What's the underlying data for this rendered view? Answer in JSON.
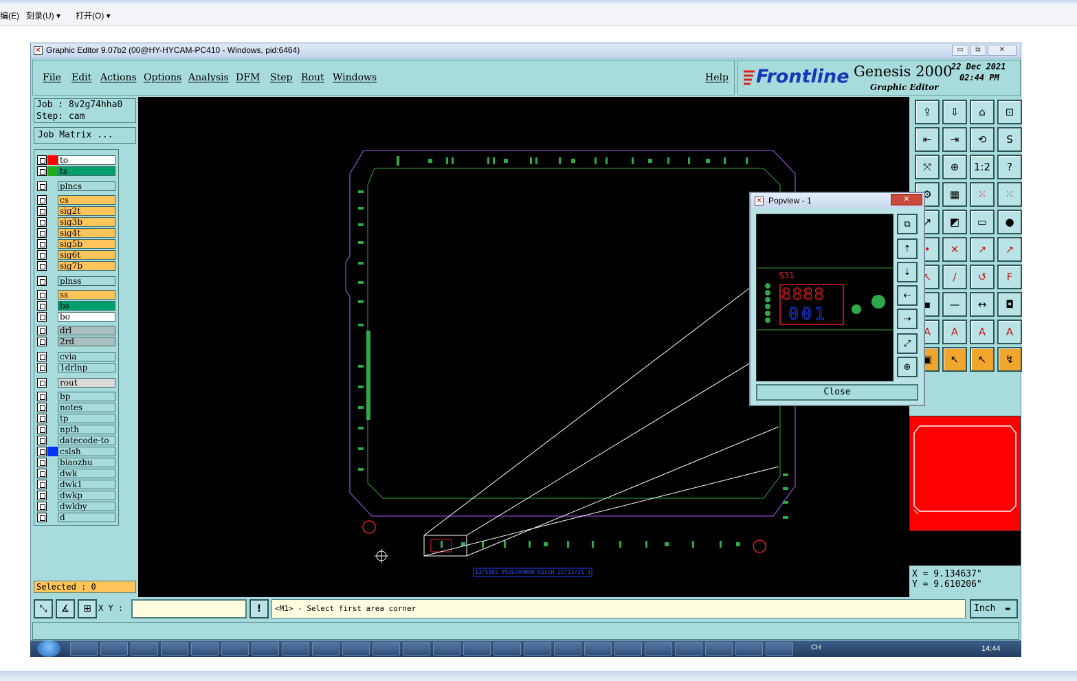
{
  "host_menu": {
    "edit": "编(E)",
    "burn": "刻录(U) ▾",
    "open": "打开(O) ▾"
  },
  "window": {
    "title": "Graphic Editor 9.07b2 (00@HY-HYCAM-PC410 - Windows, pid:6464)",
    "minimize": "▭",
    "restore": "⧉",
    "close": "✕"
  },
  "menu": {
    "file": "File",
    "edit": "Edit",
    "actions": "Actions",
    "options": "Options",
    "analysis": "Analysis",
    "dfm": "DFM",
    "step": "Step",
    "rout": "Rout",
    "windows": "Windows",
    "help": "Help"
  },
  "logo": {
    "brand": "Frontline",
    "product": "Genesis 2000",
    "subtitle": "Graphic Editor",
    "date": "22 Dec 2021",
    "time": "02:44 PM"
  },
  "job": {
    "job_line": "Job : 8v2g74hha0",
    "step_line": "Step: cam",
    "matrix_button": "Job Matrix ..."
  },
  "layers": [
    {
      "name": "to",
      "swatch": "#ff0000",
      "fill": "#ffffff"
    },
    {
      "name": "ts",
      "swatch": "#22aa22",
      "fill": "#00a06c"
    },
    {
      "name": "plncs",
      "swatch": "",
      "fill": "#a7dbdc"
    },
    {
      "name": "cs",
      "swatch": "",
      "fill": "#ffc45a"
    },
    {
      "name": "sig2t",
      "swatch": "",
      "fill": "#ffc45a"
    },
    {
      "name": "sig3b",
      "swatch": "",
      "fill": "#ffc45a"
    },
    {
      "name": "sig4t",
      "swatch": "",
      "fill": "#ffc45a"
    },
    {
      "name": "sig5b",
      "swatch": "",
      "fill": "#ffc45a"
    },
    {
      "name": "sig6t",
      "swatch": "",
      "fill": "#ffc45a"
    },
    {
      "name": "sig7b",
      "swatch": "",
      "fill": "#ffc45a"
    },
    {
      "name": "plnss",
      "swatch": "",
      "fill": "#a7dbdc"
    },
    {
      "name": "ss",
      "swatch": "",
      "fill": "#ffc45a"
    },
    {
      "name": "bs",
      "swatch": "",
      "fill": "#00a06c"
    },
    {
      "name": "bo",
      "swatch": "",
      "fill": "#ffffff"
    },
    {
      "name": "drl",
      "swatch": "",
      "fill": "#a9bfc0"
    },
    {
      "name": "2rd",
      "swatch": "",
      "fill": "#a9bfc0"
    },
    {
      "name": "cvia",
      "swatch": "",
      "fill": "#a7dbdc"
    },
    {
      "name": "1drlnp",
      "swatch": "",
      "fill": "#a7dbdc"
    },
    {
      "name": "rout",
      "swatch": "",
      "fill": "#d9d9d9"
    },
    {
      "name": "bp",
      "swatch": "",
      "fill": "#a7dbdc"
    },
    {
      "name": "notes",
      "swatch": "",
      "fill": "#a7dbdc"
    },
    {
      "name": "tp",
      "swatch": "",
      "fill": "#a7dbdc"
    },
    {
      "name": "npth",
      "swatch": "",
      "fill": "#a7dbdc"
    },
    {
      "name": "datecode-to",
      "swatch": "",
      "fill": "#a7dbdc"
    },
    {
      "name": "cslsh",
      "swatch": "#0033ff",
      "fill": "#a7dbdc"
    },
    {
      "name": "biaozhu",
      "swatch": "",
      "fill": "#a7dbdc"
    },
    {
      "name": "dwk",
      "swatch": "",
      "fill": "#a7dbdc"
    },
    {
      "name": "dwk1",
      "swatch": "",
      "fill": "#a7dbdc"
    },
    {
      "name": "dwkp",
      "swatch": "",
      "fill": "#a7dbdc"
    },
    {
      "name": "dwkby",
      "swatch": "",
      "fill": "#a7dbdc"
    },
    {
      "name": "d",
      "swatch": "",
      "fill": "#a7dbdc"
    }
  ],
  "selected": "Selected : 0",
  "popview": {
    "title": "Popview - 1",
    "close": "Close",
    "label": "S31",
    "digits_top": "8888",
    "digits_bottom": "001",
    "close_x": "✕"
  },
  "board": {
    "datecode_text": "13/5302  8V2G74HHA0 CSLSH 22/12/21 14C14"
  },
  "coords": {
    "x": "X = 9.134637\"",
    "y": "Y = 9.610206\""
  },
  "cmd": {
    "xy_label": "X Y :",
    "xy_value": "",
    "prompt": "<M1> - Select first area corner",
    "units": "Inch",
    "warn": "!"
  },
  "taskbar": {
    "lang": "CH",
    "time": "14:44"
  }
}
